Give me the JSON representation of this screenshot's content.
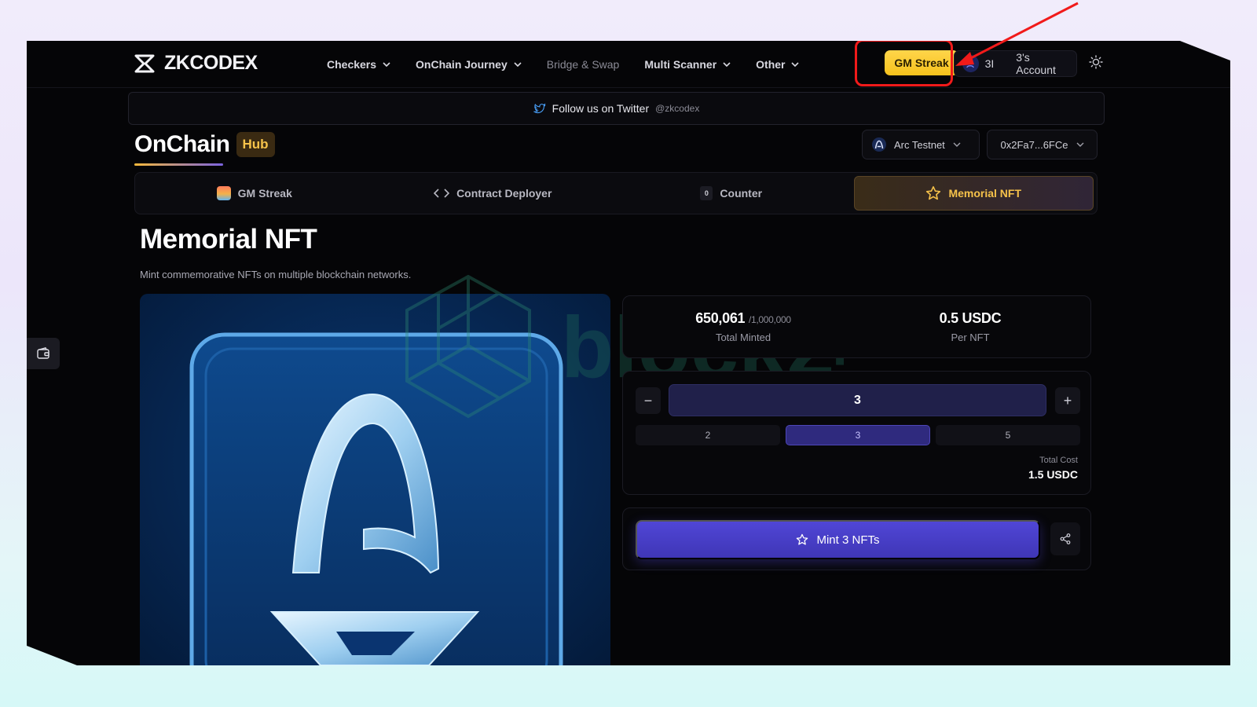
{
  "brand": {
    "name": "ZKCODEX"
  },
  "nav": {
    "items": [
      {
        "label": "Checkers",
        "dropdown": true
      },
      {
        "label": "OnChain Journey",
        "dropdown": true
      },
      {
        "label": "Bridge & Swap",
        "dropdown": false
      },
      {
        "label": "Multi Scanner",
        "dropdown": true
      },
      {
        "label": "Other",
        "dropdown": true
      }
    ],
    "gm_streak_label": "GM Streak",
    "account_short": "3I",
    "account_label": "3's Account"
  },
  "twitter": {
    "text": "Follow us on Twitter",
    "handle": "@zkcodex"
  },
  "hub": {
    "title": "OnChain",
    "badge": "Hub"
  },
  "network": {
    "name": "Arc Testnet",
    "address": "0x2Fa7...6FCe"
  },
  "tabs": [
    {
      "label": "GM Streak",
      "icon": "gm-streak-icon",
      "active": false
    },
    {
      "label": "Contract Deployer",
      "icon": "code-icon",
      "active": false
    },
    {
      "label": "Counter",
      "icon": "counter-icon",
      "counter_value": "0",
      "active": false
    },
    {
      "label": "Memorial NFT",
      "icon": "star-icon",
      "active": true
    }
  ],
  "page": {
    "title": "Memorial NFT",
    "subtitle": "Mint commemorative NFTs on multiple blockchain networks."
  },
  "stats": {
    "minted": "650,061",
    "supply": "/1,000,000",
    "minted_label": "Total Minted",
    "price": "0.5 USDC",
    "price_label": "Per NFT"
  },
  "quantity": {
    "value": "3",
    "minus": "−",
    "plus": "+",
    "presets": [
      {
        "label": "2",
        "selected": false
      },
      {
        "label": "3",
        "selected": true
      },
      {
        "label": "5",
        "selected": false
      }
    ],
    "total_label": "Total Cost",
    "total_value": "1.5 USDC"
  },
  "mint": {
    "label": "Mint 3 NFTs"
  },
  "watermark": {
    "text": "block24"
  },
  "colors": {
    "accent": "#f6c24a",
    "mint": "#4a41cc",
    "highlight": "#f11a1a",
    "gm_button": "#f9c923"
  }
}
